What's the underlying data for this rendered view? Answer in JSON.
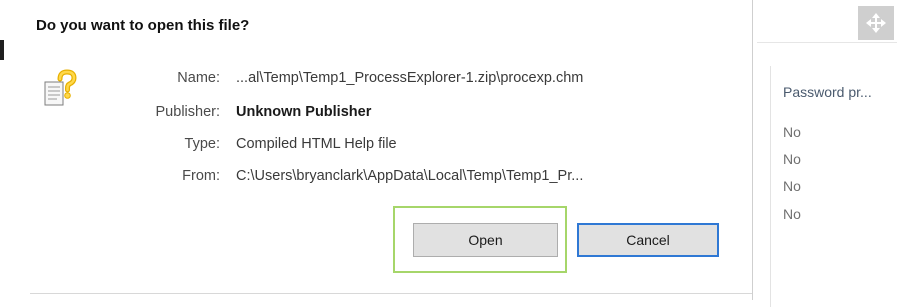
{
  "dialog": {
    "title": "Do you want to open this file?",
    "icon": "help-document-icon",
    "fields": {
      "name_label": "Name:",
      "name_value": "...al\\Temp\\Temp1_ProcessExplorer-1.zip\\procexp.chm",
      "publisher_label": "Publisher:",
      "publisher_value": "Unknown Publisher",
      "type_label": "Type:",
      "type_value": "Compiled HTML Help file",
      "from_label": "From:",
      "from_value": "C:\\Users\\bryanclark\\AppData\\Local\\Temp\\Temp1_Pr..."
    },
    "buttons": {
      "open_label": "Open",
      "cancel_label": "Cancel"
    },
    "highlight_color": "#a6d66a",
    "default_button_border": "#2f78d4"
  },
  "background_window": {
    "move_icon": "move-arrows-icon",
    "column_header": "Password pr...",
    "rows": [
      "No",
      "No",
      "No",
      "No"
    ]
  }
}
